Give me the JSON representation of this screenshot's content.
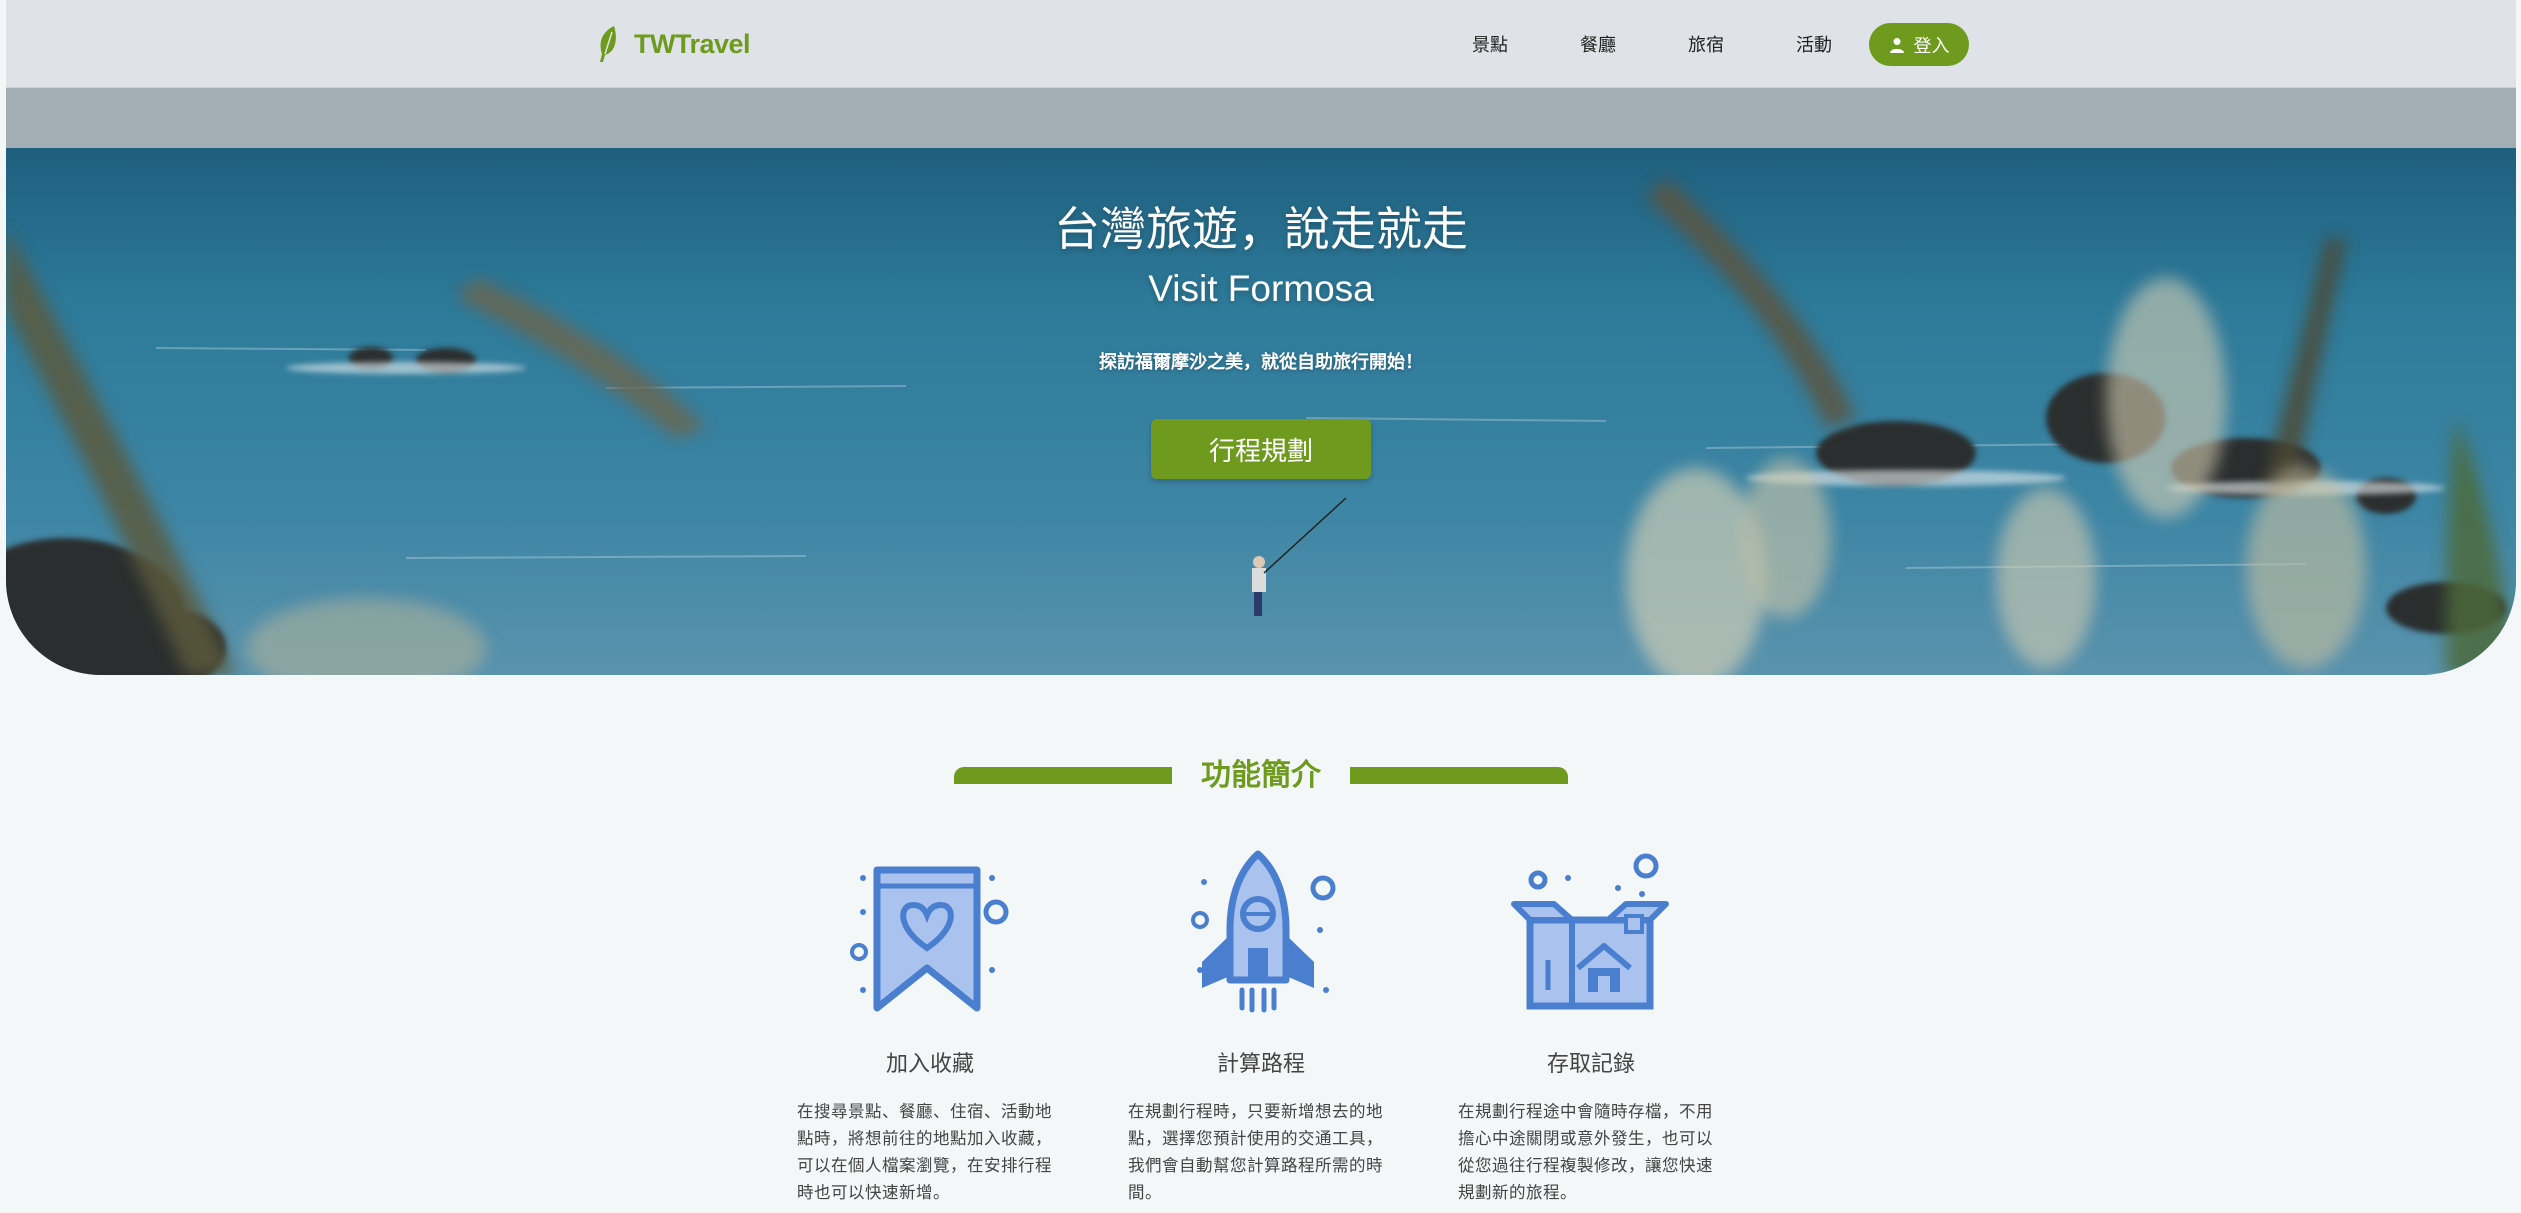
{
  "brand": {
    "name": "TWTravel"
  },
  "nav": {
    "links": [
      "景點",
      "餐廳",
      "旅宿",
      "活動"
    ],
    "login_label": "登入"
  },
  "hero": {
    "title": "台灣旅遊，說走就走",
    "subtitle": "Visit Formosa",
    "tagline": "探訪福爾摩沙之美，就從自助旅行開始！",
    "cta_label": "行程規劃"
  },
  "features": {
    "title": "功能簡介",
    "items": [
      {
        "icon": "bookmark-heart-icon",
        "title": "加入收藏",
        "desc": "在搜尋景點、餐廳、住宿、活動地點時，將想前往的地點加入收藏，可以在個人檔案瀏覽，在安排行程時也可以快速新增。"
      },
      {
        "icon": "rocket-icon",
        "title": "計算路程",
        "desc": "在規劃行程時，只要新增想去的地點，選擇您預計使用的交通工具，我們會自動幫您計算路程所需的時間。"
      },
      {
        "icon": "open-box-icon",
        "title": "存取記錄",
        "desc": "在規劃行程途中會隨時存檔，不用擔心中途關閉或意外發生，也可以從您過往行程複製修改，讓您快速規劃新的旅程。"
      }
    ]
  },
  "colors": {
    "accent": "#6e9a1e",
    "icon_blue": "#4a7fd0",
    "icon_fill": "#a9c2ee"
  }
}
